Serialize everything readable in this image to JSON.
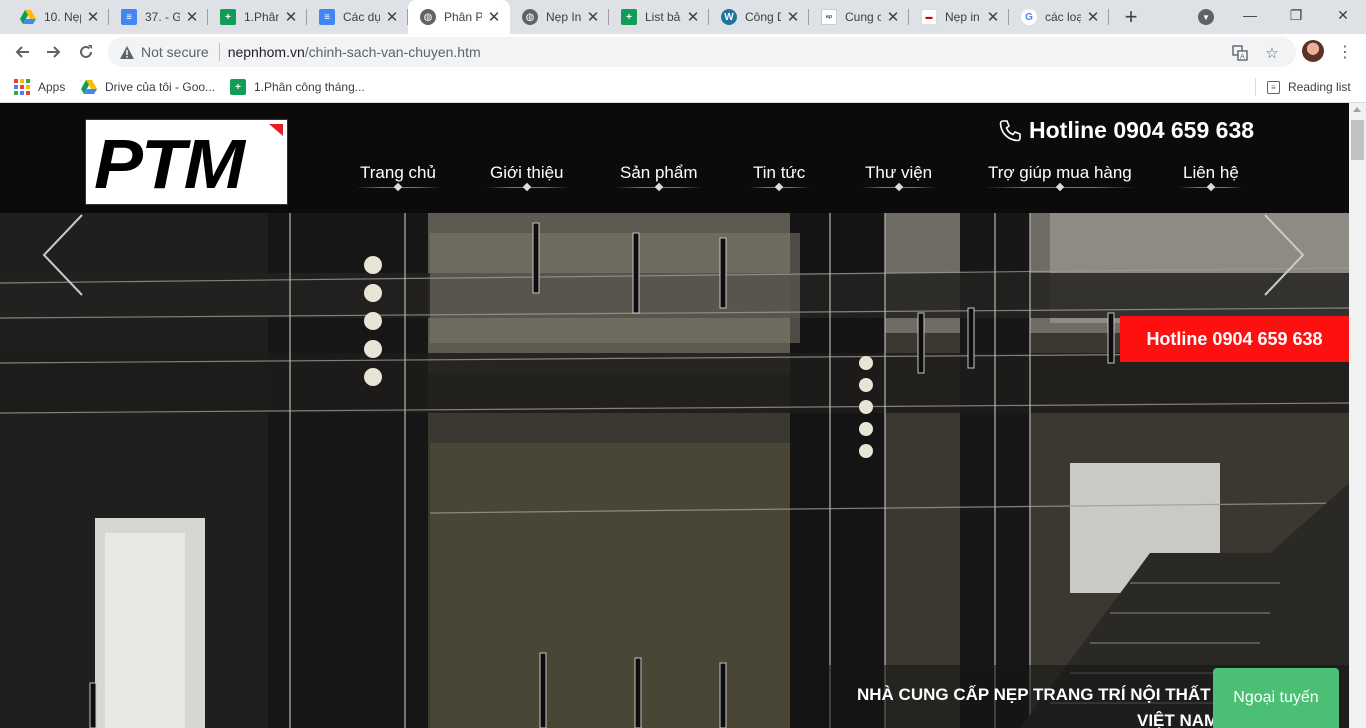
{
  "browser": {
    "tabs": [
      {
        "title": "10. Nẹp",
        "icon": "google-drive-icon",
        "active": false
      },
      {
        "title": "37. - G",
        "icon": "google-docs-icon",
        "active": false
      },
      {
        "title": "1.Phân",
        "icon": "google-sheets-icon",
        "active": false
      },
      {
        "title": "Các dự",
        "icon": "google-docs-icon",
        "active": false
      },
      {
        "title": "Phân P",
        "icon": "globe-icon",
        "active": true
      },
      {
        "title": "Nẹp In",
        "icon": "globe-icon",
        "active": false
      },
      {
        "title": "List bả",
        "icon": "google-sheets-icon",
        "active": false
      },
      {
        "title": "Công D",
        "icon": "wordpress-icon",
        "active": false
      },
      {
        "title": "Cung c",
        "icon": "site-icon",
        "active": false
      },
      {
        "title": "Nẹp in",
        "icon": "site-icon",
        "active": false
      },
      {
        "title": "các loạ",
        "icon": "google-icon",
        "active": false
      }
    ],
    "security_label": "Not secure",
    "url_host": "nepnhom.vn",
    "url_path": "/chinh-sach-van-chuyen.htm",
    "bookmarks": [
      {
        "label": "Apps",
        "icon": "apps-grid-icon"
      },
      {
        "label": "Drive của tôi - Goo...",
        "icon": "google-drive-icon"
      },
      {
        "label": "1.Phân công tháng...",
        "icon": "google-sheets-icon"
      }
    ],
    "reading_list_label": "Reading list"
  },
  "site": {
    "logo_text": "PTM",
    "hotline": "Hotline 0904 659 638",
    "nav": [
      {
        "label": "Trang chủ"
      },
      {
        "label": "Giới thiệu"
      },
      {
        "label": "Sản phẩm"
      },
      {
        "label": "Tin tức"
      },
      {
        "label": "Thư viện"
      },
      {
        "label": "Trợ giúp mua hàng"
      },
      {
        "label": "Liên hệ"
      }
    ],
    "hero": {
      "hotline_badge": "Hotline 0904 659 638",
      "caption_line1": "NHÀ CUNG CẤP NẸP TRANG TRÍ NỘI THẤT SỐ",
      "caption_line2": "VIỆT NAM"
    },
    "chat_label": "Ngoại tuyến"
  },
  "colors": {
    "header_bg": "#0b0b0b",
    "hotline_badge_bg": "#ff1010",
    "chat_bg": "#4bbf73"
  }
}
